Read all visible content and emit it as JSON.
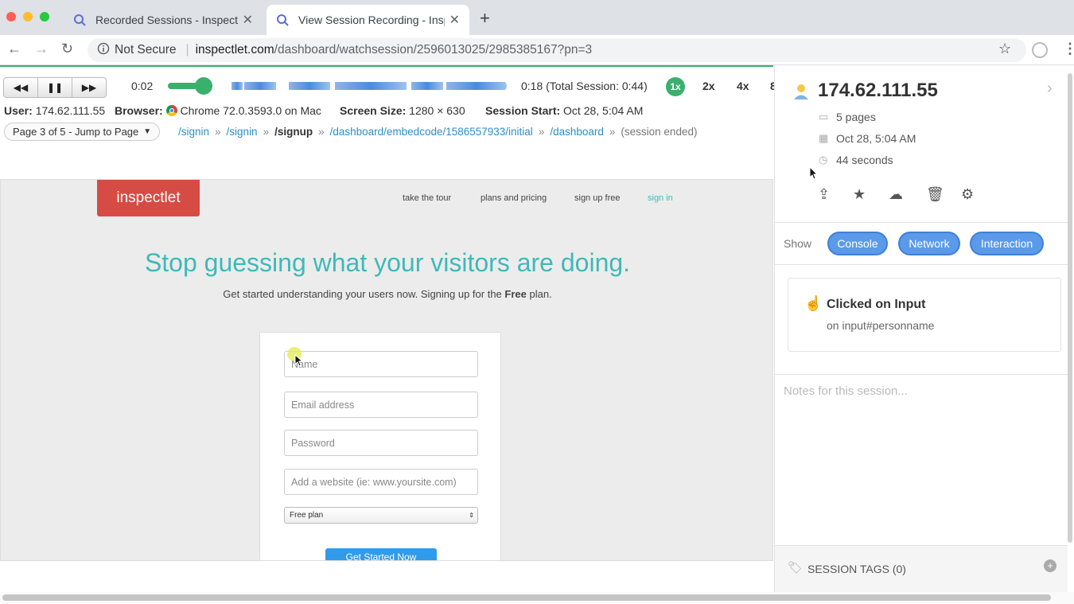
{
  "browser": {
    "tabs": [
      {
        "title": "Recorded Sessions - Inspectlet",
        "active": false
      },
      {
        "title": "View Session Recording - Inspectlet",
        "active": true
      }
    ],
    "security_label": "Not Secure",
    "url_host": "inspectlet.com",
    "url_path": "/dashboard/watchsession/2596013025/2985385167?pn=3"
  },
  "player": {
    "current_time": "0:02",
    "end_label": "0:18 (Total Session: 0:44)",
    "progress": 0.09,
    "speeds": [
      "1x",
      "2x",
      "4x",
      "8"
    ],
    "active_speed": "1x",
    "user_label": "User:",
    "user_value": "174.62.111.55",
    "browser_label": "Browser:",
    "browser_value": "Chrome 72.0.3593.0 on Mac",
    "screen_label": "Screen Size:",
    "screen_value": "1280 × 630",
    "start_label": "Session Start:",
    "start_value": "Oct 28, 5:04 AM",
    "page_selector": "Page 3 of 5 - Jump to Page",
    "breadcrumb": [
      {
        "label": "/signin",
        "current": false
      },
      {
        "label": "/signin",
        "current": false
      },
      {
        "label": "/signup",
        "current": true
      },
      {
        "label": "/dashboard/embedcode/1586557933/initial",
        "current": false
      },
      {
        "label": "/dashboard",
        "current": false
      }
    ],
    "breadcrumb_end": "(session ended)"
  },
  "replay": {
    "logo": "inspectlet",
    "nav": [
      "take the tour",
      "plans and pricing",
      "sign up free",
      "sign in"
    ],
    "headline": "Stop guessing what your visitors are doing.",
    "subtitle_pre": "Get started understanding your users now. Signing up for the ",
    "subtitle_bold": "Free",
    "subtitle_post": " plan.",
    "form": {
      "name_placeholder": "Name",
      "email_placeholder": "Email address",
      "password_placeholder": "Password",
      "website_placeholder": "Add a website (ie: www.yoursite.com)",
      "plan_value": "Free plan",
      "submit_label": "Get Started Now"
    }
  },
  "sidebar": {
    "ip": "174.62.111.55",
    "pages": "5 pages",
    "date": "Oct 28, 5:04 AM",
    "duration": "44 seconds",
    "show_label": "Show",
    "filters": [
      "Console",
      "Network",
      "Interaction"
    ],
    "event_title": "Clicked on Input",
    "event_detail": "on input#personname",
    "notes_placeholder": "Notes for this session...",
    "tags_label": "SESSION TAGS (0)"
  },
  "colors": {
    "accent_green": "#3ab06d",
    "link_blue": "#2a8fc9",
    "pill_blue": "#5b9ae9",
    "logo_red": "#d64b43",
    "headline_teal": "#3dbab8"
  }
}
